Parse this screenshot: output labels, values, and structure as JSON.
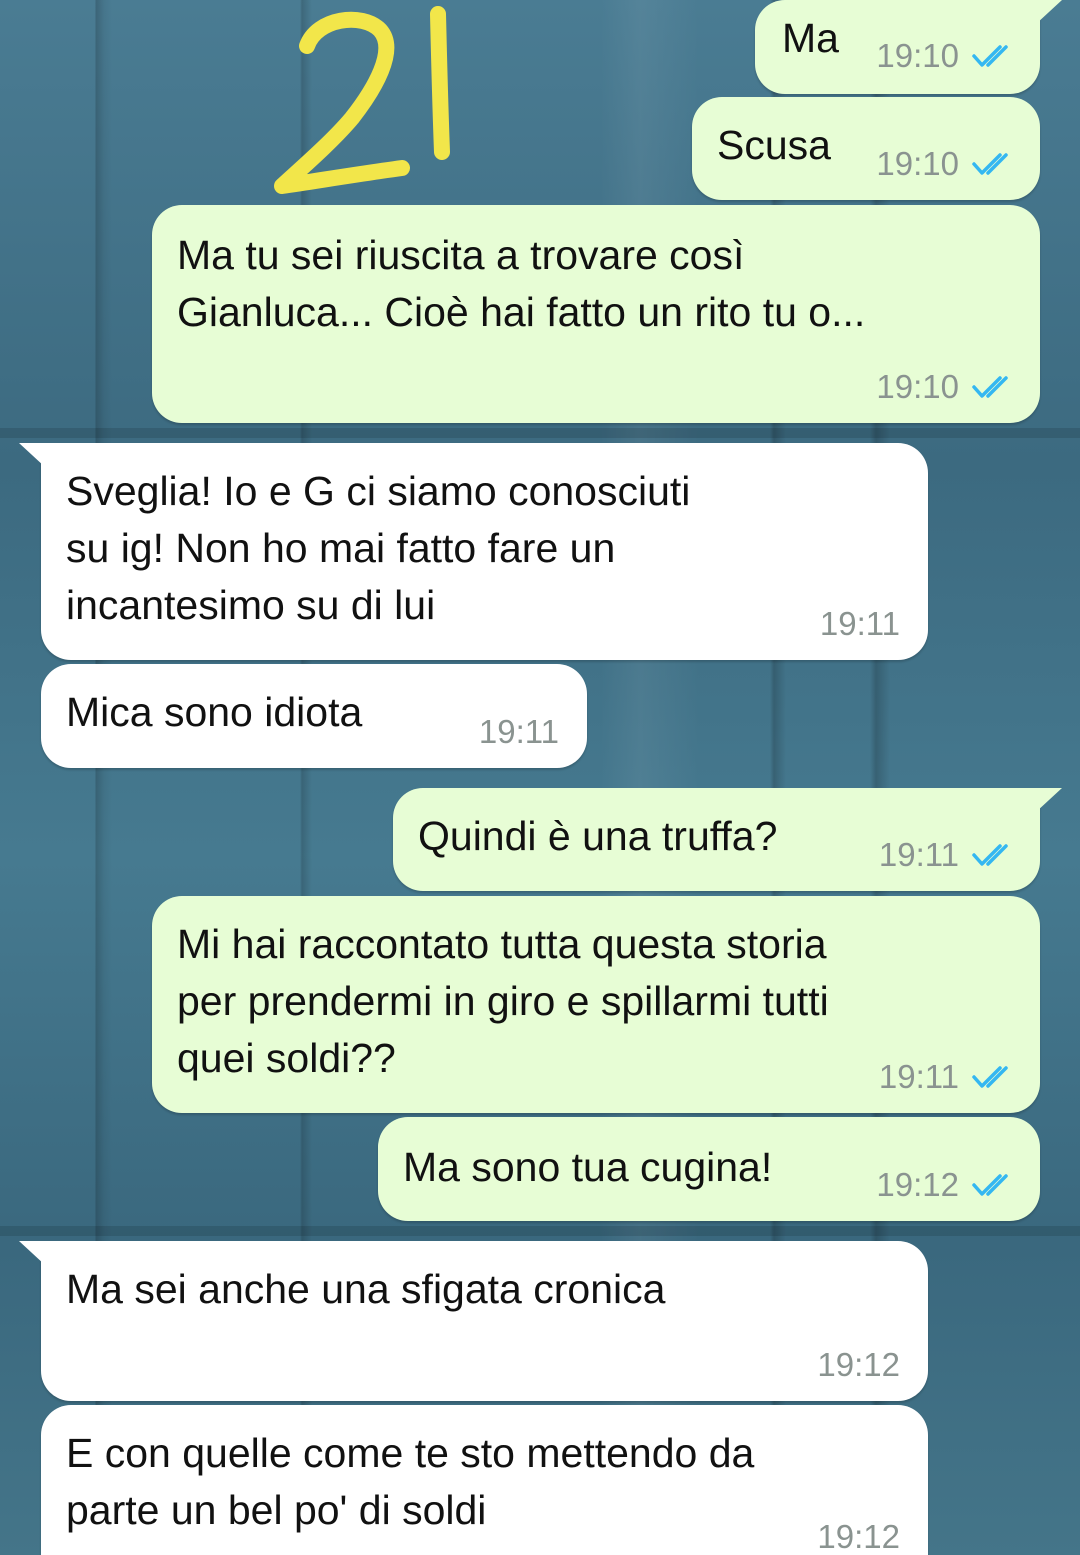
{
  "sticker": {
    "text": "21",
    "color": "#f2e64a"
  },
  "colors": {
    "outgoing_bubble": "#e7fdd5",
    "incoming_bubble": "#ffffff",
    "read_ticks": "#34b7f1",
    "timestamp": "#8a9390"
  },
  "messages": [
    {
      "direction": "outgoing",
      "text": "Ma",
      "time": "19:10",
      "status": "read"
    },
    {
      "direction": "outgoing",
      "text": "Scusa",
      "time": "19:10",
      "status": "read"
    },
    {
      "direction": "outgoing",
      "text": "Ma tu sei riuscita a trovare così\nGianluca... Cioè hai fatto un rito tu o...",
      "time": "19:10",
      "status": "read"
    },
    {
      "direction": "incoming",
      "text": "Sveglia! Io e G ci siamo conosciuti\nsu ig! Non ho mai fatto fare un\nincantesimo su di lui",
      "time": "19:11"
    },
    {
      "direction": "incoming",
      "text": "Mica sono idiota",
      "time": "19:11"
    },
    {
      "direction": "outgoing",
      "text": "Quindi è una truffa?",
      "time": "19:11",
      "status": "read"
    },
    {
      "direction": "outgoing",
      "text": "Mi hai raccontato tutta questa storia\nper prendermi in giro e spillarmi tutti\nquei soldi??",
      "time": "19:11",
      "status": "read"
    },
    {
      "direction": "outgoing",
      "text": "Ma sono tua cugina!",
      "time": "19:12",
      "status": "read"
    },
    {
      "direction": "incoming",
      "text": "Ma sei anche una sfigata cronica",
      "time": "19:12"
    },
    {
      "direction": "incoming",
      "text": "E con quelle come te sto mettendo da\nparte un bel po' di soldi",
      "time": "19:12"
    }
  ]
}
